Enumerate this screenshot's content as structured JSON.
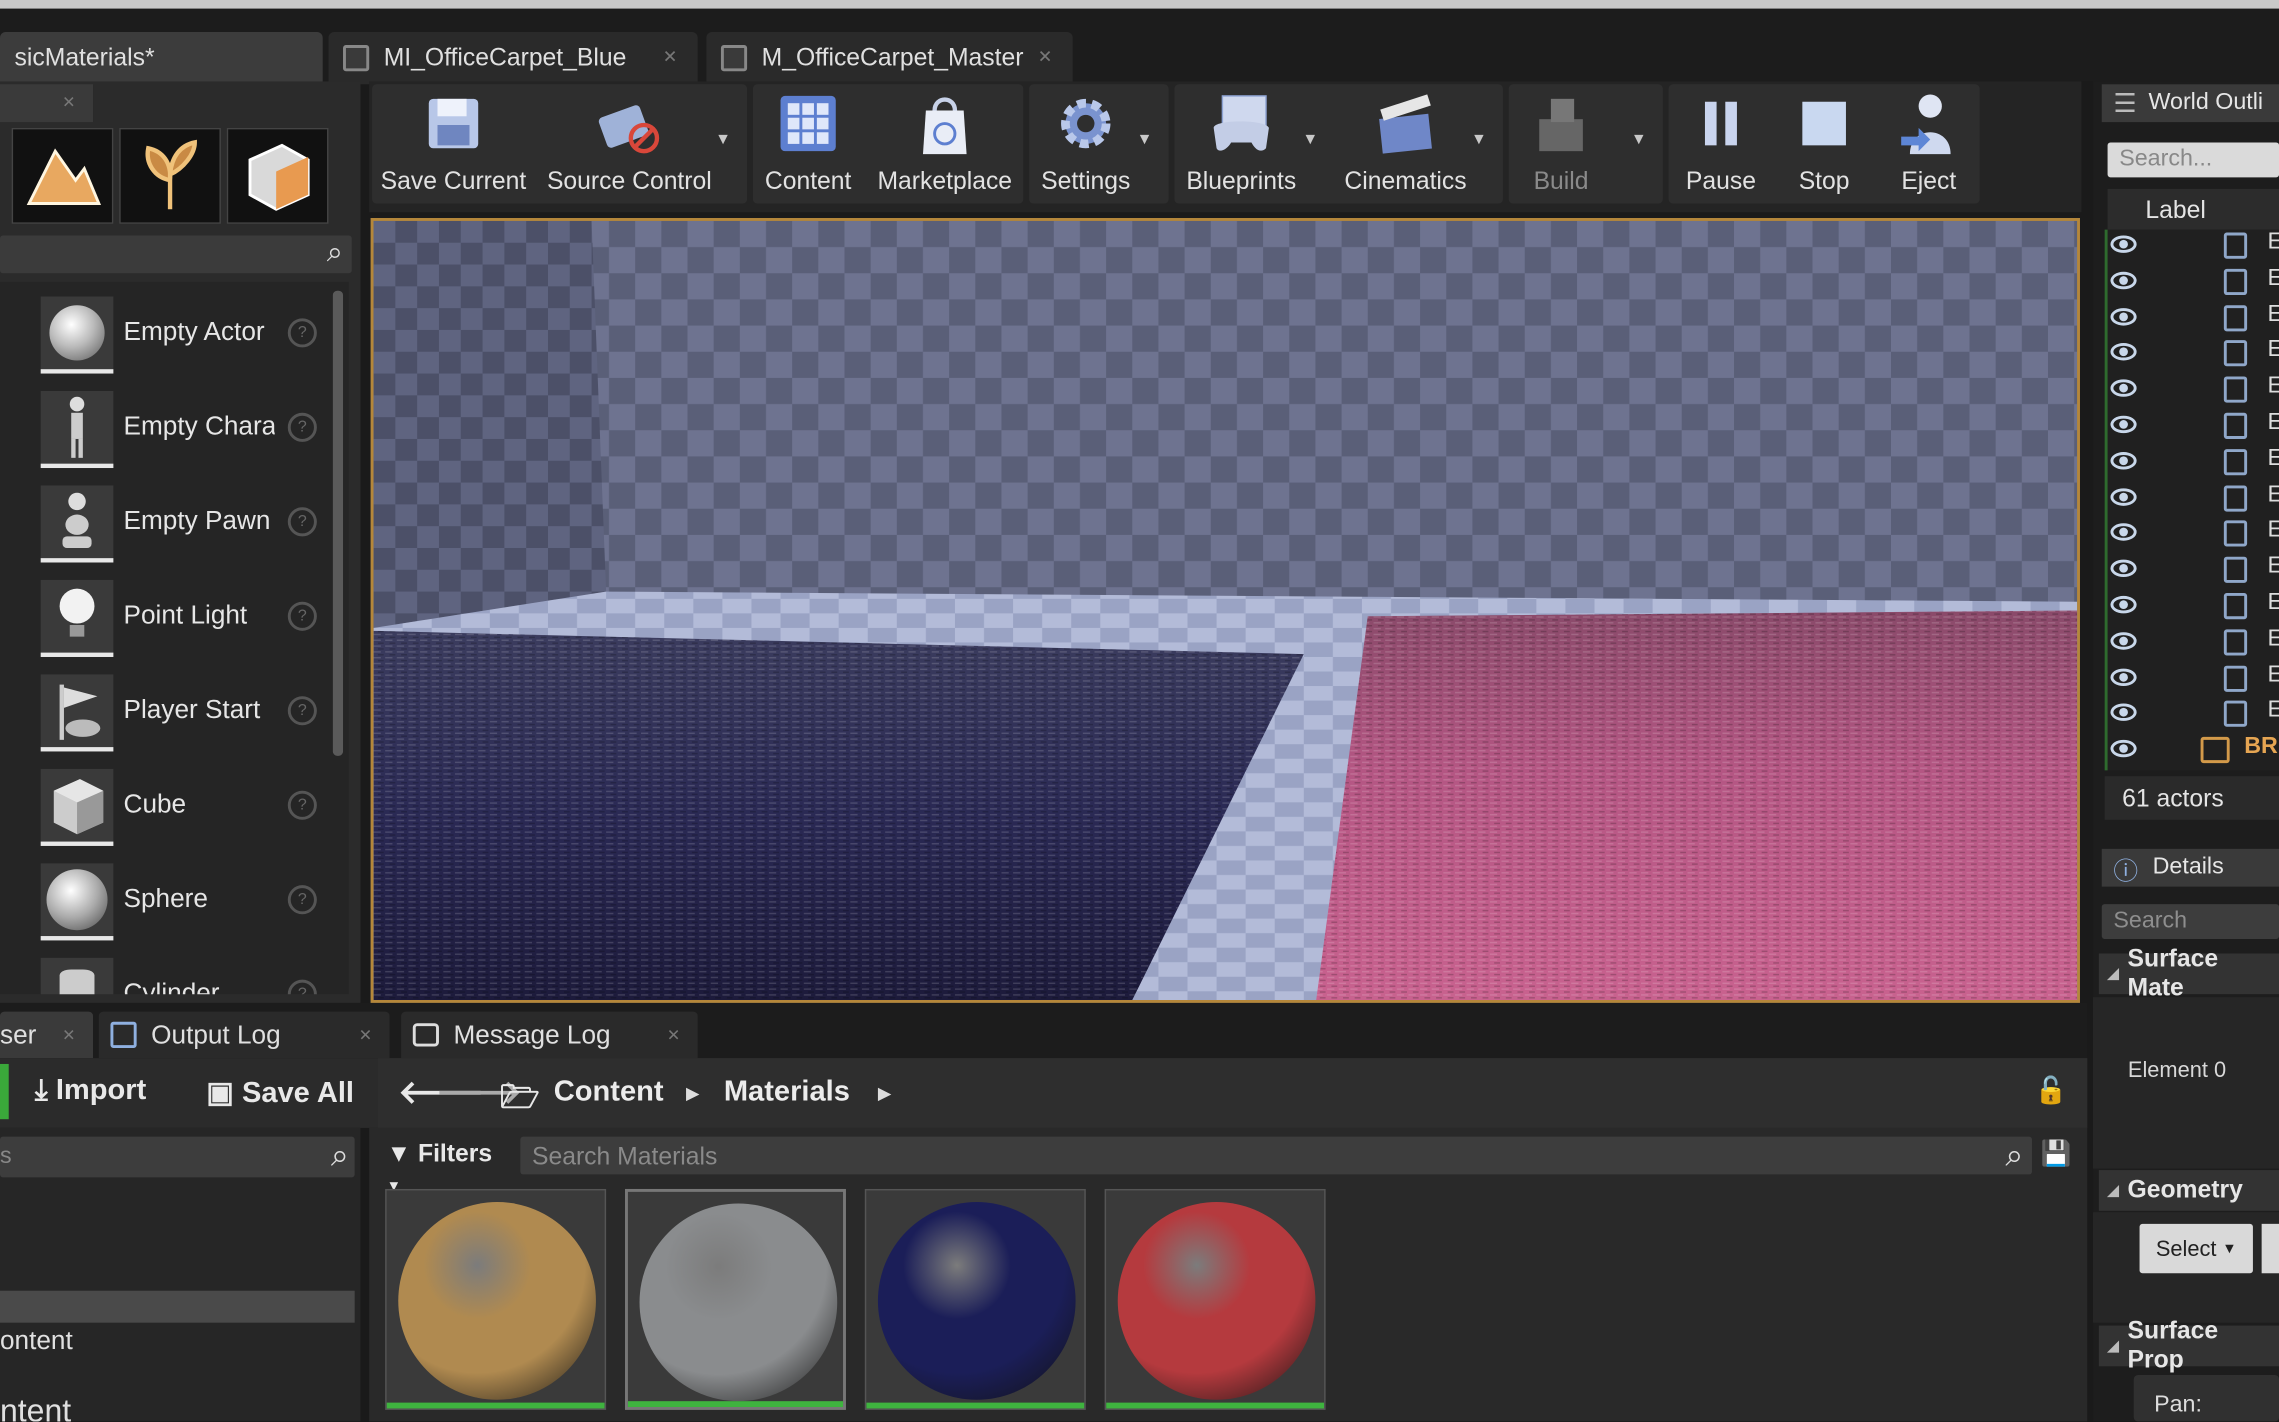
{
  "tabs": [
    {
      "label": "sicMaterials*",
      "active": true
    },
    {
      "label": "MI_OfficeCarpet_Blue",
      "active": false
    },
    {
      "label": "M_OfficeCarpet_Master",
      "active": false
    }
  ],
  "modes": {
    "icons": [
      "landscape-icon",
      "foliage-icon",
      "mesh-paint-icon"
    ],
    "items": [
      {
        "label": "Empty Actor",
        "icon": "sphere-icon"
      },
      {
        "label": "Empty Chara",
        "icon": "character-icon"
      },
      {
        "label": "Empty Pawn",
        "icon": "pawn-icon"
      },
      {
        "label": "Point Light",
        "icon": "light-bulb-icon"
      },
      {
        "label": "Player Start",
        "icon": "flag-icon"
      },
      {
        "label": "Cube",
        "icon": "cube-icon"
      },
      {
        "label": "Sphere",
        "icon": "sphere-icon"
      },
      {
        "label": "Cylinder",
        "icon": "cylinder-icon"
      }
    ]
  },
  "toolbar": {
    "save": "Save Current",
    "source_control": "Source Control",
    "content": "Content",
    "marketplace": "Marketplace",
    "settings": "Settings",
    "blueprints": "Blueprints",
    "cinematics": "Cinematics",
    "build": "Build",
    "pause": "Pause",
    "stop": "Stop",
    "eject": "Eject"
  },
  "outliner": {
    "title": "World Outli",
    "search_placeholder": "Search...",
    "column_label": "Label",
    "row_letter": "E",
    "last_row": "BR",
    "actor_count": "61 actors"
  },
  "details": {
    "title": "Details",
    "search_placeholder": "Search",
    "section_surface": "Surface Mate",
    "element0": "Element 0",
    "section_geometry": "Geometry",
    "select_label": "Select",
    "section_surface_props": "Surface Prop",
    "pan_label": "Pan:"
  },
  "bottom": {
    "tab_left": "ser",
    "tab_output": "Output Log",
    "tab_message": "Message Log",
    "import": "Import",
    "save_all": "Save All",
    "crumb_content": "Content",
    "crumb_materials": "Materials",
    "filters": "Filters",
    "search_placeholder": "Search Materials",
    "left_search": "s",
    "tree_item1": "ontent",
    "tree_item2": "ntent"
  },
  "assets": [
    {
      "color": "#b08a50"
    },
    {
      "color": "#8a8c8e"
    },
    {
      "color": "#1b1e58"
    },
    {
      "color": "#b53a3e"
    }
  ],
  "colors": {
    "accent": "#b5873a",
    "asset_bar": "#3fb33f",
    "carpet_blue": "#2d2d55",
    "carpet_pink": "#c25c8a"
  }
}
